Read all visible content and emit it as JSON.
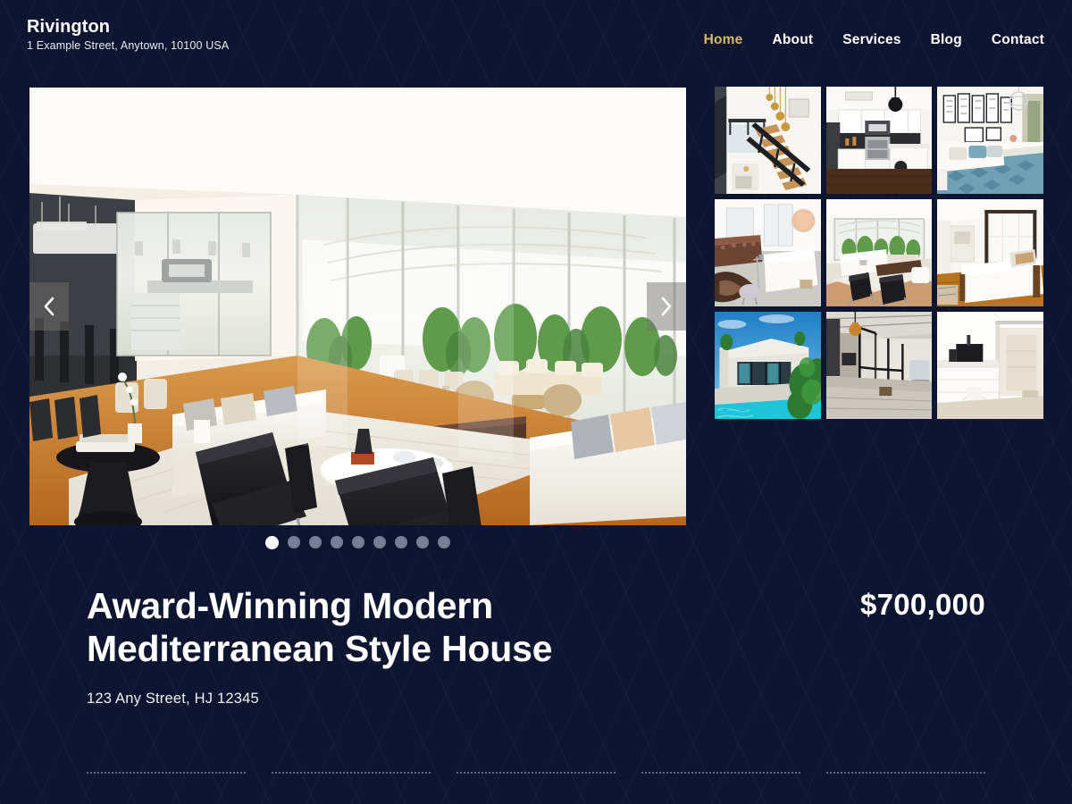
{
  "site": {
    "brand_name": "Rivington",
    "brand_address": "1 Example Street, Anytown, 10100 USA",
    "accent_color": "#d9b668",
    "background_color": "#0d1530"
  },
  "nav": {
    "items": [
      {
        "label": "Home",
        "active": true
      },
      {
        "label": "About",
        "active": false
      },
      {
        "label": "Services",
        "active": false
      },
      {
        "label": "Blog",
        "active": false
      },
      {
        "label": "Contact",
        "active": false
      }
    ]
  },
  "carousel": {
    "prev_icon": "chevron-left-icon",
    "next_icon": "chevron-right-icon",
    "active_slide": 1,
    "total_slides": 9,
    "slide_alt": "Modern open-plan living room with white sofas, black armchairs and glass doors to a planted patio"
  },
  "thumbnails": {
    "items": [
      {
        "alt": "Atrium with floating wooden staircase and pendant lights"
      },
      {
        "alt": "White kitchen with stainless steel range and black backsplash"
      },
      {
        "alt": "Bedroom with framed art gallery wall and patterned bedding"
      },
      {
        "alt": "Living space with cowhide rug and ottoman"
      },
      {
        "alt": "Sunlit lounge with black armchairs facing the garden"
      },
      {
        "alt": "Bedroom with tall wooden canopy bed frame"
      },
      {
        "alt": "Exterior of the house with swimming pool and palms"
      },
      {
        "alt": "Industrial corridor with black-framed glass partitions"
      },
      {
        "alt": "White bathroom with walk-in glass shower"
      }
    ]
  },
  "listing": {
    "title": "Award-Winning Modern Mediterranean Style House",
    "address": "123 Any Street, HJ 12345",
    "price": "$700,000"
  },
  "stats": {
    "rails": [
      {
        "id": "rail-1"
      },
      {
        "id": "rail-2"
      },
      {
        "id": "rail-3"
      },
      {
        "id": "rail-4"
      },
      {
        "id": "rail-5"
      }
    ]
  }
}
